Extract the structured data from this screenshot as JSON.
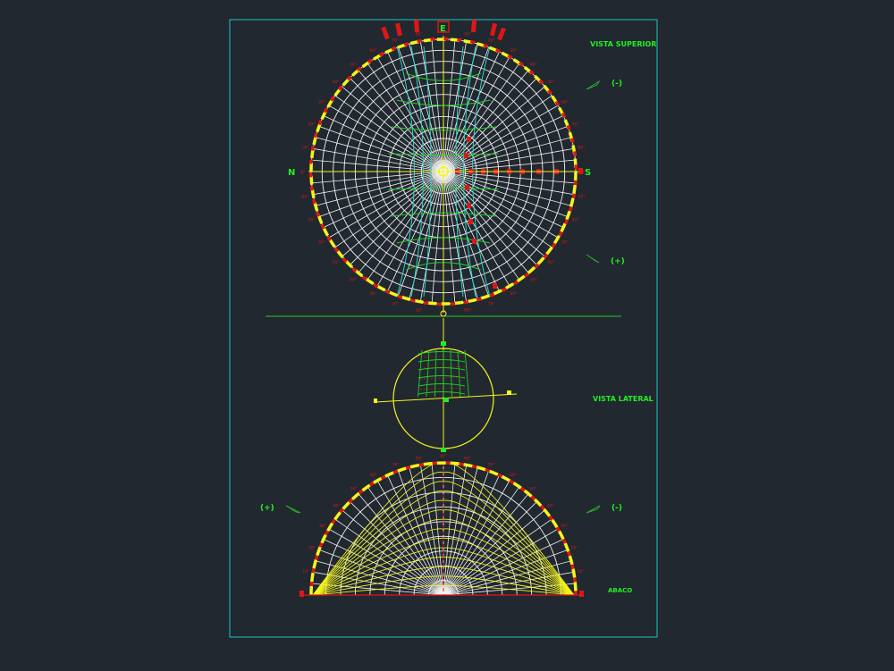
{
  "colors": {
    "background": "#212830",
    "frame": "#19c4c4",
    "grid_white": "#f2f2f2",
    "grid_yellow": "#f5f51a",
    "grid_green": "#22cc22",
    "grid_cyan": "#2ed3c8",
    "mark_red": "#e01616",
    "label_green": "#22ee22"
  },
  "labels": {
    "vista_superior": "VISTA SUPERIOR",
    "vista_lateral": "VISTA LATERAL",
    "abaco": "ABACO",
    "north": "N",
    "south": "S",
    "east": "E",
    "minus": "(-)",
    "plus": "(+)"
  },
  "icons": [
    "leaf-arrow-icon"
  ],
  "degree_tick_step": 10
}
